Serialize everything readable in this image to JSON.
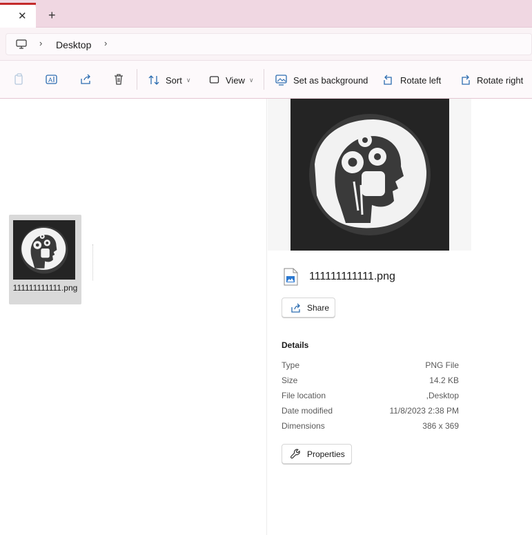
{
  "tabs": {
    "close_glyph": "✕",
    "new_tab_glyph": "+"
  },
  "address_bar": {
    "crumbs": [
      "Desktop"
    ],
    "root_icon": "pc-icon",
    "separator_icon": "chevron-right-icon"
  },
  "toolbar": {
    "icons": [
      "copy-icon",
      "rename-icon",
      "share-icon",
      "delete-icon"
    ],
    "sort_label": "Sort",
    "view_label": "View",
    "set_background_label": "Set as background",
    "rotate_left_label": "Rotate left",
    "rotate_right_label": "Rotate right"
  },
  "file_list": {
    "items": [
      {
        "name": "111111111111.png"
      }
    ]
  },
  "details_pane": {
    "file_name": "111111111111.png",
    "share_label": "Share",
    "details_heading": "Details",
    "properties": [
      {
        "label": "Type",
        "value": "PNG File"
      },
      {
        "label": "Size",
        "value": "14.2 KB"
      },
      {
        "label": "File location",
        "value": ",Desktop"
      },
      {
        "label": "Date modified",
        "value": "11/8/2023 2:38 PM"
      },
      {
        "label": "Dimensions",
        "value": "386 x 369"
      }
    ],
    "properties_button_label": "Properties"
  },
  "colors": {
    "title_bar": "#f0d7e2",
    "tab_accent": "#c42b2b",
    "toolbar_icon": "#2b6cb0",
    "image_background": "#242424"
  }
}
